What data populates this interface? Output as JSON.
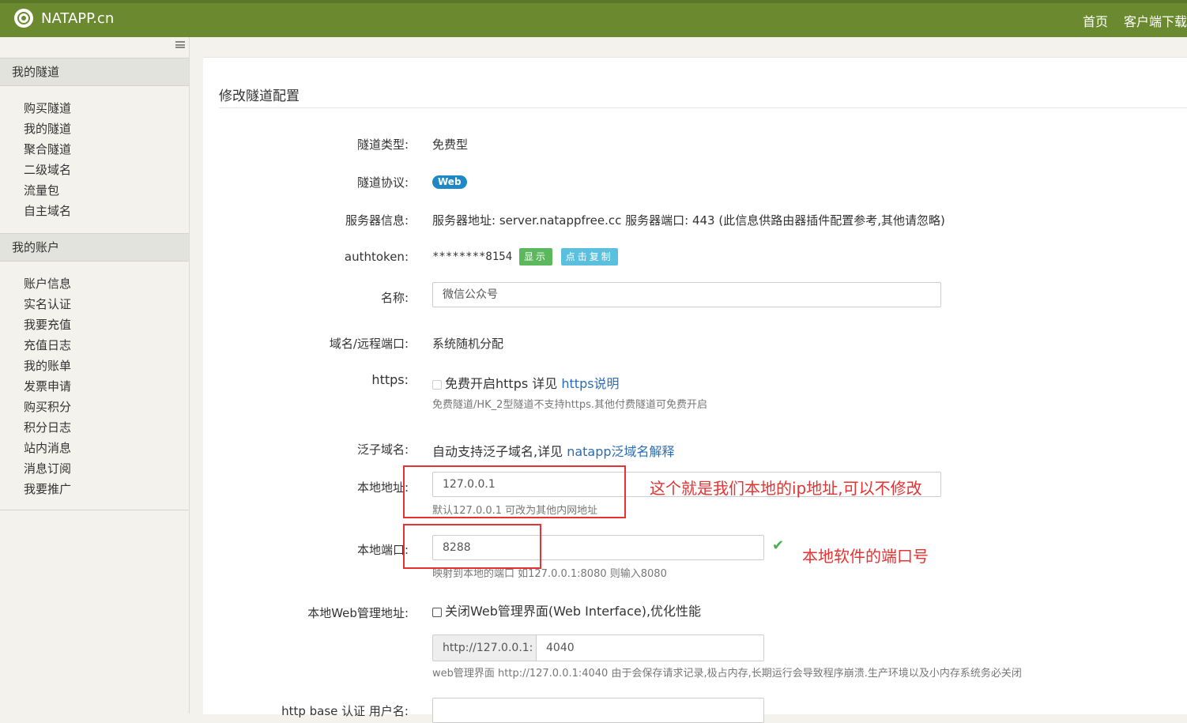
{
  "header": {
    "brand": "NATAPP.cn",
    "nav": [
      "首页",
      "客户端下载"
    ]
  },
  "sidebar": {
    "sections": [
      {
        "title": "我的隧道",
        "items": [
          "购买隧道",
          "我的隧道",
          "聚合隧道",
          "二级域名",
          "流量包",
          "自主域名"
        ]
      },
      {
        "title": "我的账户",
        "items": [
          "账户信息",
          "实名认证",
          "我要充值",
          "充值日志",
          "我的账单",
          "发票申请",
          "购买积分",
          "积分日志",
          "站内消息",
          "消息订阅",
          "我要推广"
        ]
      }
    ]
  },
  "main": {
    "title": "修改隧道配置",
    "tunnel_type_label": "隧道类型:",
    "tunnel_type_value": "免费型",
    "protocol_label": "隧道协议:",
    "protocol_badge": "Web",
    "server_label": "服务器信息:",
    "server_value": "服务器地址: server.natappfree.cc 服务器端口: 443 (此信息供路由器插件配置参考,其他请忽略)",
    "authtoken_label": "authtoken:",
    "authtoken_value": "********8154",
    "show_button": "显示",
    "copy_button": "点击复制",
    "name_label": "名称:",
    "name_value": "微信公众号",
    "domain_label": "域名/远程端口:",
    "domain_value": "系统随机分配",
    "https_label": "https:",
    "https_checkbox_text": "免费开启https 详见",
    "https_link": "https说明",
    "https_help": "免费隧道/HK_2型隧道不支持https.其他付费隧道可免费开启",
    "wildcard_label": "泛子域名:",
    "wildcard_text": "自动支持泛子域名,详见",
    "wildcard_link": "natapp泛域名解释",
    "local_addr_label": "本地地址:",
    "local_addr_value": "127.0.0.1",
    "local_addr_help": "默认127.0.0.1 可改为其他内网地址",
    "local_port_label": "本地端口:",
    "local_port_value": "8288",
    "local_port_help": "映射到本地的端口 如127.0.0.1:8080 则输入8080",
    "web_admin_label": "本地Web管理地址:",
    "web_admin_checkbox_text": "关闭Web管理界面(Web Interface),优化性能",
    "web_admin_prefix": "http://127.0.0.1:",
    "web_admin_port": "4040",
    "web_admin_help": "web管理界面 http://127.0.0.1:4040 由于会保存请求记录,极占内存,长期运行会导致程序崩溃.生产环境以及小内存系统务必关闭",
    "basic_auth_label": "http base 认证 用户名:"
  },
  "annotations": {
    "ip_note": "这个就是我们本地的ip地址,可以不修改",
    "port_note": "本地软件的端口号"
  },
  "colors": {
    "topbar": "#6b8a2f",
    "show_button": "#5cb85c",
    "copy_button": "#5bc0de",
    "annotation": "#e53333",
    "badge": "#1e88c7"
  }
}
